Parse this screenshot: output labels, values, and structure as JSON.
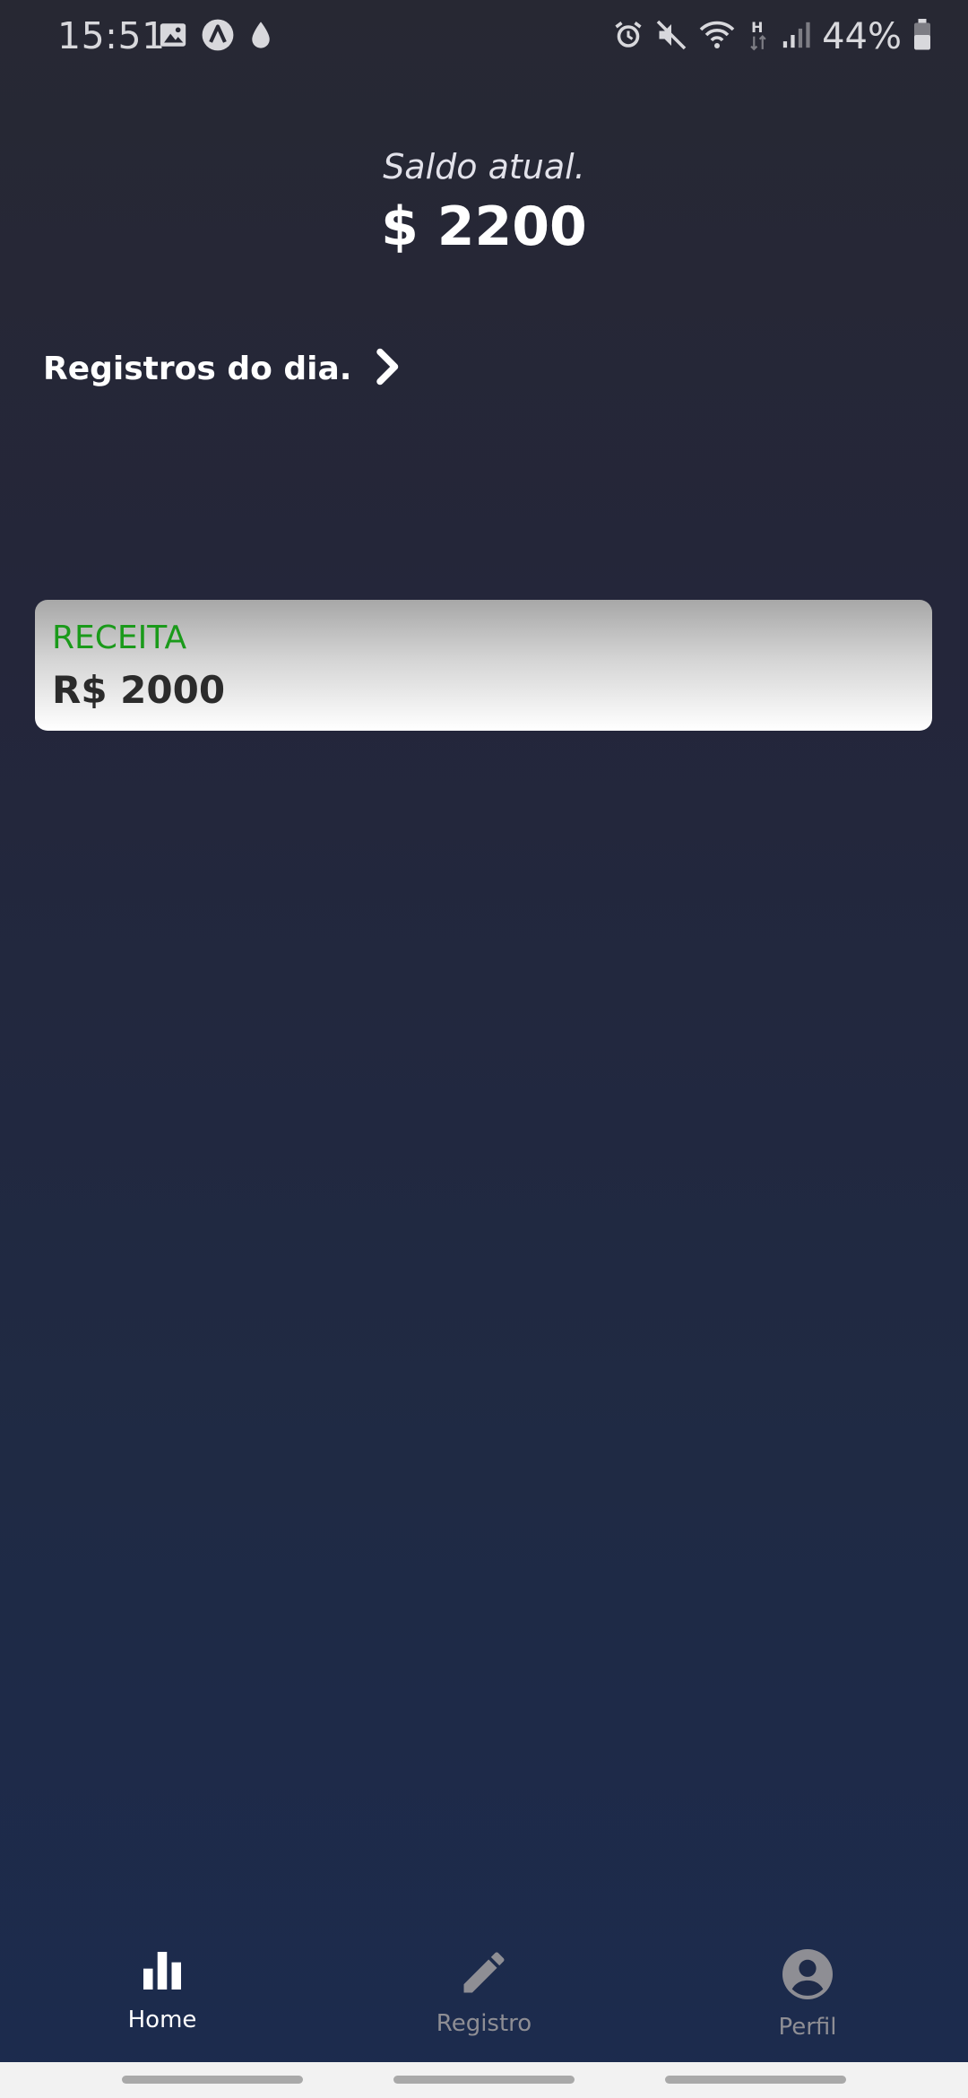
{
  "status_bar": {
    "time": "15:51",
    "battery_percent": "44%",
    "left_icons": [
      "image-icon",
      "app-a-icon",
      "drop-icon"
    ],
    "right_icons": [
      "alarm-icon",
      "mute-icon",
      "wifi-icon",
      "data-h-icon",
      "signal-icon",
      "battery-icon"
    ]
  },
  "balance": {
    "label": "Saldo atual.",
    "value": "$ 2200"
  },
  "records": {
    "title": "Registros do dia.",
    "icon": "chevron-right-icon"
  },
  "entries": [
    {
      "type": "RECEITA",
      "amount": "R$ 2000",
      "type_color": "#1a9a1a"
    }
  ],
  "bottom_nav": {
    "items": [
      {
        "label": "Home",
        "icon": "bar-chart-icon",
        "active": true
      },
      {
        "label": "Registro",
        "icon": "pencil-icon",
        "active": false
      },
      {
        "label": "Perfil",
        "icon": "account-circle-icon",
        "active": false
      }
    ]
  },
  "colors": {
    "background_top": "#272833",
    "background_bottom": "#1c2b4e",
    "active_nav": "#ffffff",
    "inactive_nav": "#8e8e94",
    "income": "#1a9a1a"
  }
}
